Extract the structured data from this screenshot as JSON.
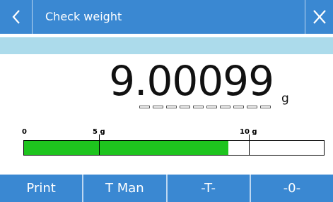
{
  "header": {
    "title": "Check weight",
    "back_icon": "chevron-left-icon",
    "close_icon": "close-icon"
  },
  "readout": {
    "value": "9.00099",
    "unit": "g"
  },
  "bargraph": {
    "labels": [
      "0",
      "5 g",
      "10 g"
    ],
    "scale_min_g": 0,
    "scale_max_g": 13.2,
    "level_g": 9.00099,
    "fill_color": "#1ec41e"
  },
  "softkeys": [
    {
      "label": "Print"
    },
    {
      "label": "T Man"
    },
    {
      "label": "-T-"
    },
    {
      "label": "-0-"
    }
  ],
  "colors": {
    "bar_blue": "#3a88d2",
    "info_band": "#acdbeb"
  }
}
